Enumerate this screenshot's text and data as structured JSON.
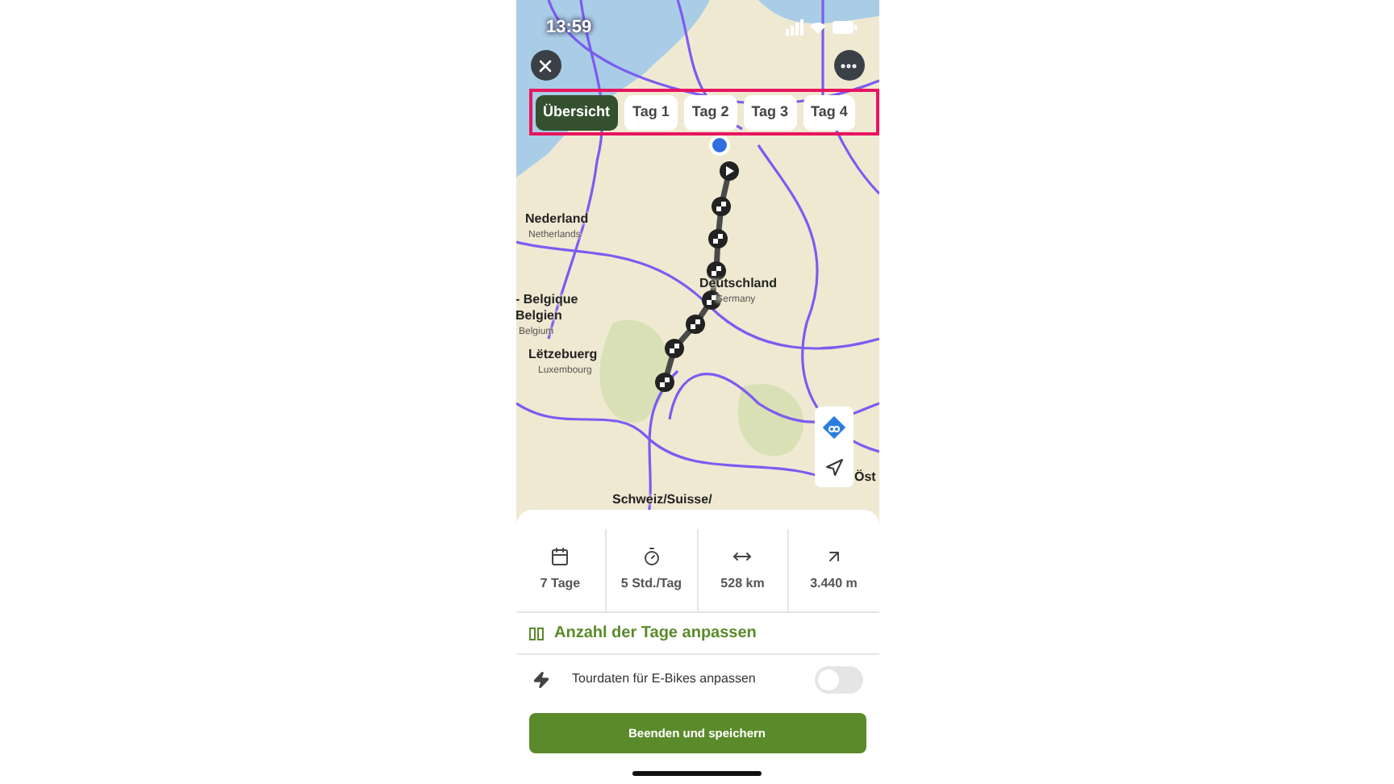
{
  "status_bar": {
    "time": "13:59"
  },
  "tabs": [
    {
      "label": "Übersicht",
      "selected": true
    },
    {
      "label": "Tag 1",
      "selected": false
    },
    {
      "label": "Tag 2",
      "selected": false
    },
    {
      "label": "Tag 3",
      "selected": false
    },
    {
      "label": "Tag 4",
      "selected": false
    }
  ],
  "map_labels": [
    {
      "text": "Nederland",
      "kind": "major"
    },
    {
      "text": "Netherlands",
      "kind": "minor"
    },
    {
      "text": "Deutschland",
      "kind": "major"
    },
    {
      "text": "Germany",
      "kind": "minor"
    },
    {
      "text": "- Belgique",
      "kind": "major"
    },
    {
      "text": "Belgien",
      "kind": "major"
    },
    {
      "text": "Belgium",
      "kind": "minor"
    },
    {
      "text": "Lëtzebuerg",
      "kind": "major"
    },
    {
      "text": "Luxembourg",
      "kind": "minor"
    },
    {
      "text": "Schweiz/Suisse/",
      "kind": "major"
    },
    {
      "text": "Öst",
      "kind": "major"
    }
  ],
  "stats": [
    {
      "kind": "days",
      "value": "7 Tage"
    },
    {
      "kind": "duration",
      "value": "5 Std./Tag"
    },
    {
      "kind": "distance",
      "value": "528 km"
    },
    {
      "kind": "elevation",
      "value": "3.440 m"
    }
  ],
  "adjust_days": {
    "label": "Anzahl der Tage anpassen"
  },
  "ebike": {
    "label": "Tourdaten für E-Bikes anpassen",
    "on": false
  },
  "save_button": {
    "label": "Beenden und speichern"
  }
}
